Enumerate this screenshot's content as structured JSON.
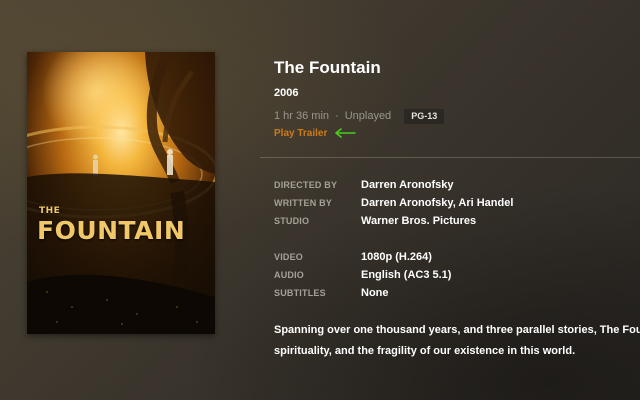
{
  "movie": {
    "title": "The Fountain",
    "year": "2006",
    "duration": "1 hr 36 min",
    "separator": "·",
    "watch_status": "Unplayed",
    "rating": "PG-13",
    "trailer_label": "Play Trailer"
  },
  "poster": {
    "title_small": "THE",
    "title_big": "FOUNTAIN"
  },
  "credits": [
    {
      "label": "DIRECTED BY",
      "value": "Darren Aronofsky"
    },
    {
      "label": "WRITTEN BY",
      "value": "Darren Aronofsky, Ari Handel"
    },
    {
      "label": "STUDIO",
      "value": "Warner Bros. Pictures"
    }
  ],
  "media": [
    {
      "label": "VIDEO",
      "value": "1080p (H.264)"
    },
    {
      "label": "AUDIO",
      "value": "English (AC3 5.1)"
    },
    {
      "label": "SUBTITLES",
      "value": "None"
    }
  ],
  "summary": {
    "line1": "Spanning over one thousand years, and three parallel stories, The Fountain is a story of love, death,",
    "line2": "spirituality, and the fragility of our existence in this world."
  },
  "icons": {
    "trailer_arrow": "arrow-left-icon"
  },
  "colors": {
    "accent": "#cc7b19",
    "annotation_arrow": "#4ccc1f",
    "rating_badge_bg": "#2b2824",
    "label_text": "#a6a198",
    "meta_text": "#9a968e"
  }
}
